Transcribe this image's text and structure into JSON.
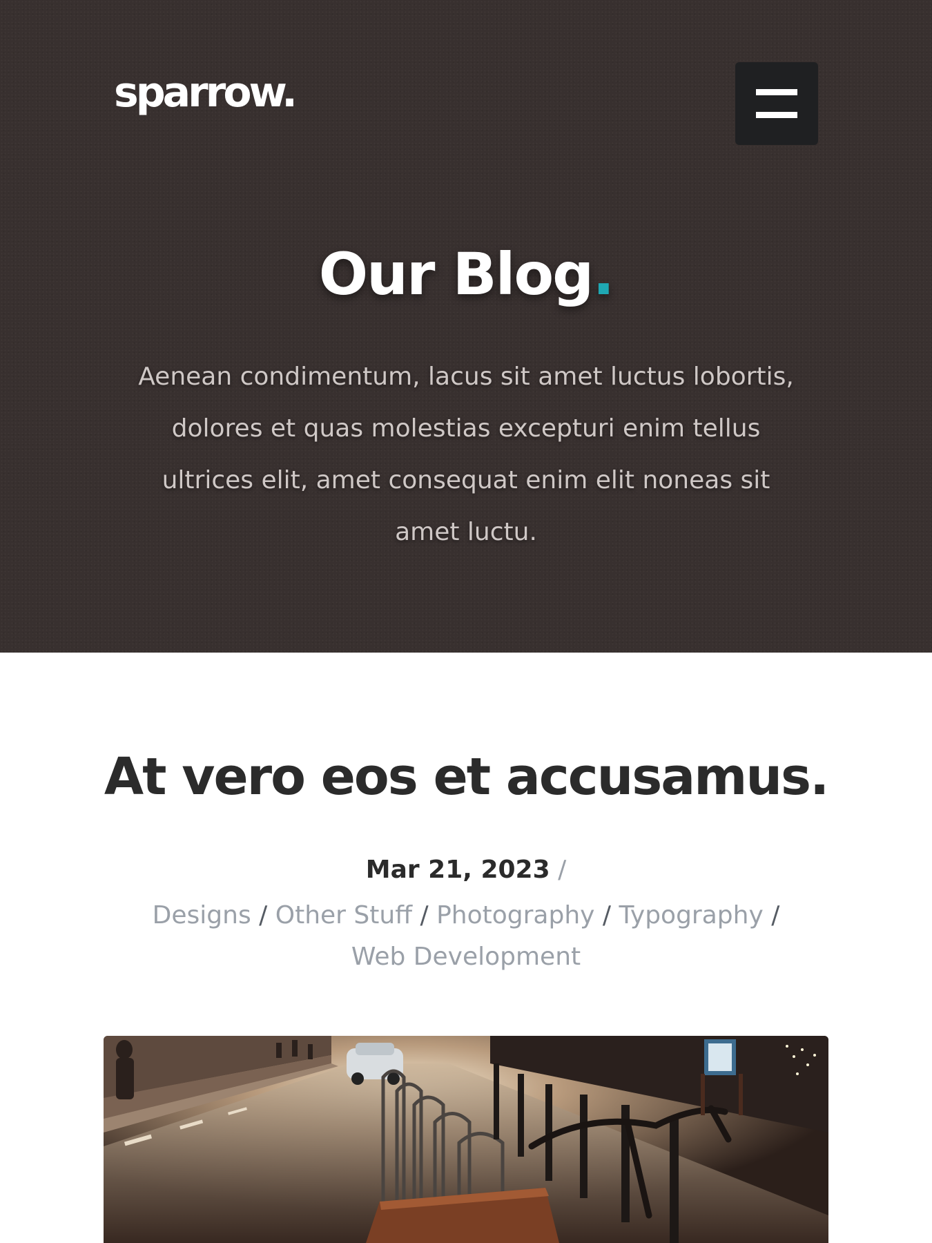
{
  "header": {
    "logo": "sparrow.",
    "menu_icon": "hamburger-menu-icon"
  },
  "hero": {
    "title": "Our Blog",
    "title_dot": ".",
    "description": "Aenean condimentum, lacus sit amet luctus lobortis, dolores et quas molestias excepturi enim tellus ultrices elit, amet consequat enim elit noneas sit amet luctu."
  },
  "post": {
    "title": "At vero eos et accusamus.",
    "date": "Mar 21, 2023",
    "separator": "/",
    "categories": [
      "Designs",
      "Other Stuff",
      "Photography",
      "Typography",
      "Web Development"
    ]
  },
  "colors": {
    "hero_background": "#38302f",
    "accent": "#1fa8b3",
    "menu_button": "#1f2022",
    "meta_text": "#9aa0a8"
  }
}
